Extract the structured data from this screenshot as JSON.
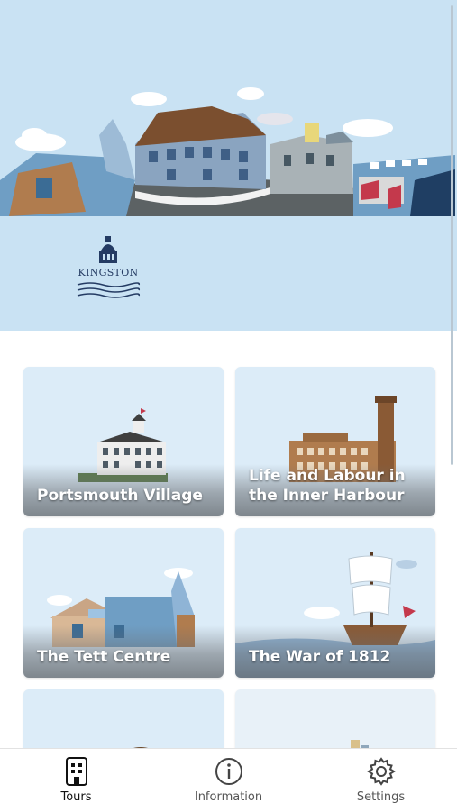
{
  "hero": {
    "logo_text": "KINGSTON"
  },
  "tours": [
    {
      "title": "Portsmouth Village"
    },
    {
      "title": "Life and Labour in the Inner Harbour"
    },
    {
      "title": "The Tett Centre"
    },
    {
      "title": "The War of 1812"
    },
    {
      "title": ""
    },
    {
      "title": ""
    }
  ],
  "tabbar": {
    "tabs": [
      {
        "label": "Tours",
        "icon": "building-icon",
        "active": true
      },
      {
        "label": "Information",
        "icon": "info-icon",
        "active": false
      },
      {
        "label": "Settings",
        "icon": "gear-icon",
        "active": false
      }
    ]
  },
  "colors": {
    "hero_sky": "#c9e2f3",
    "card_sky": "#dcecf8",
    "brand_navy": "#243b63"
  }
}
